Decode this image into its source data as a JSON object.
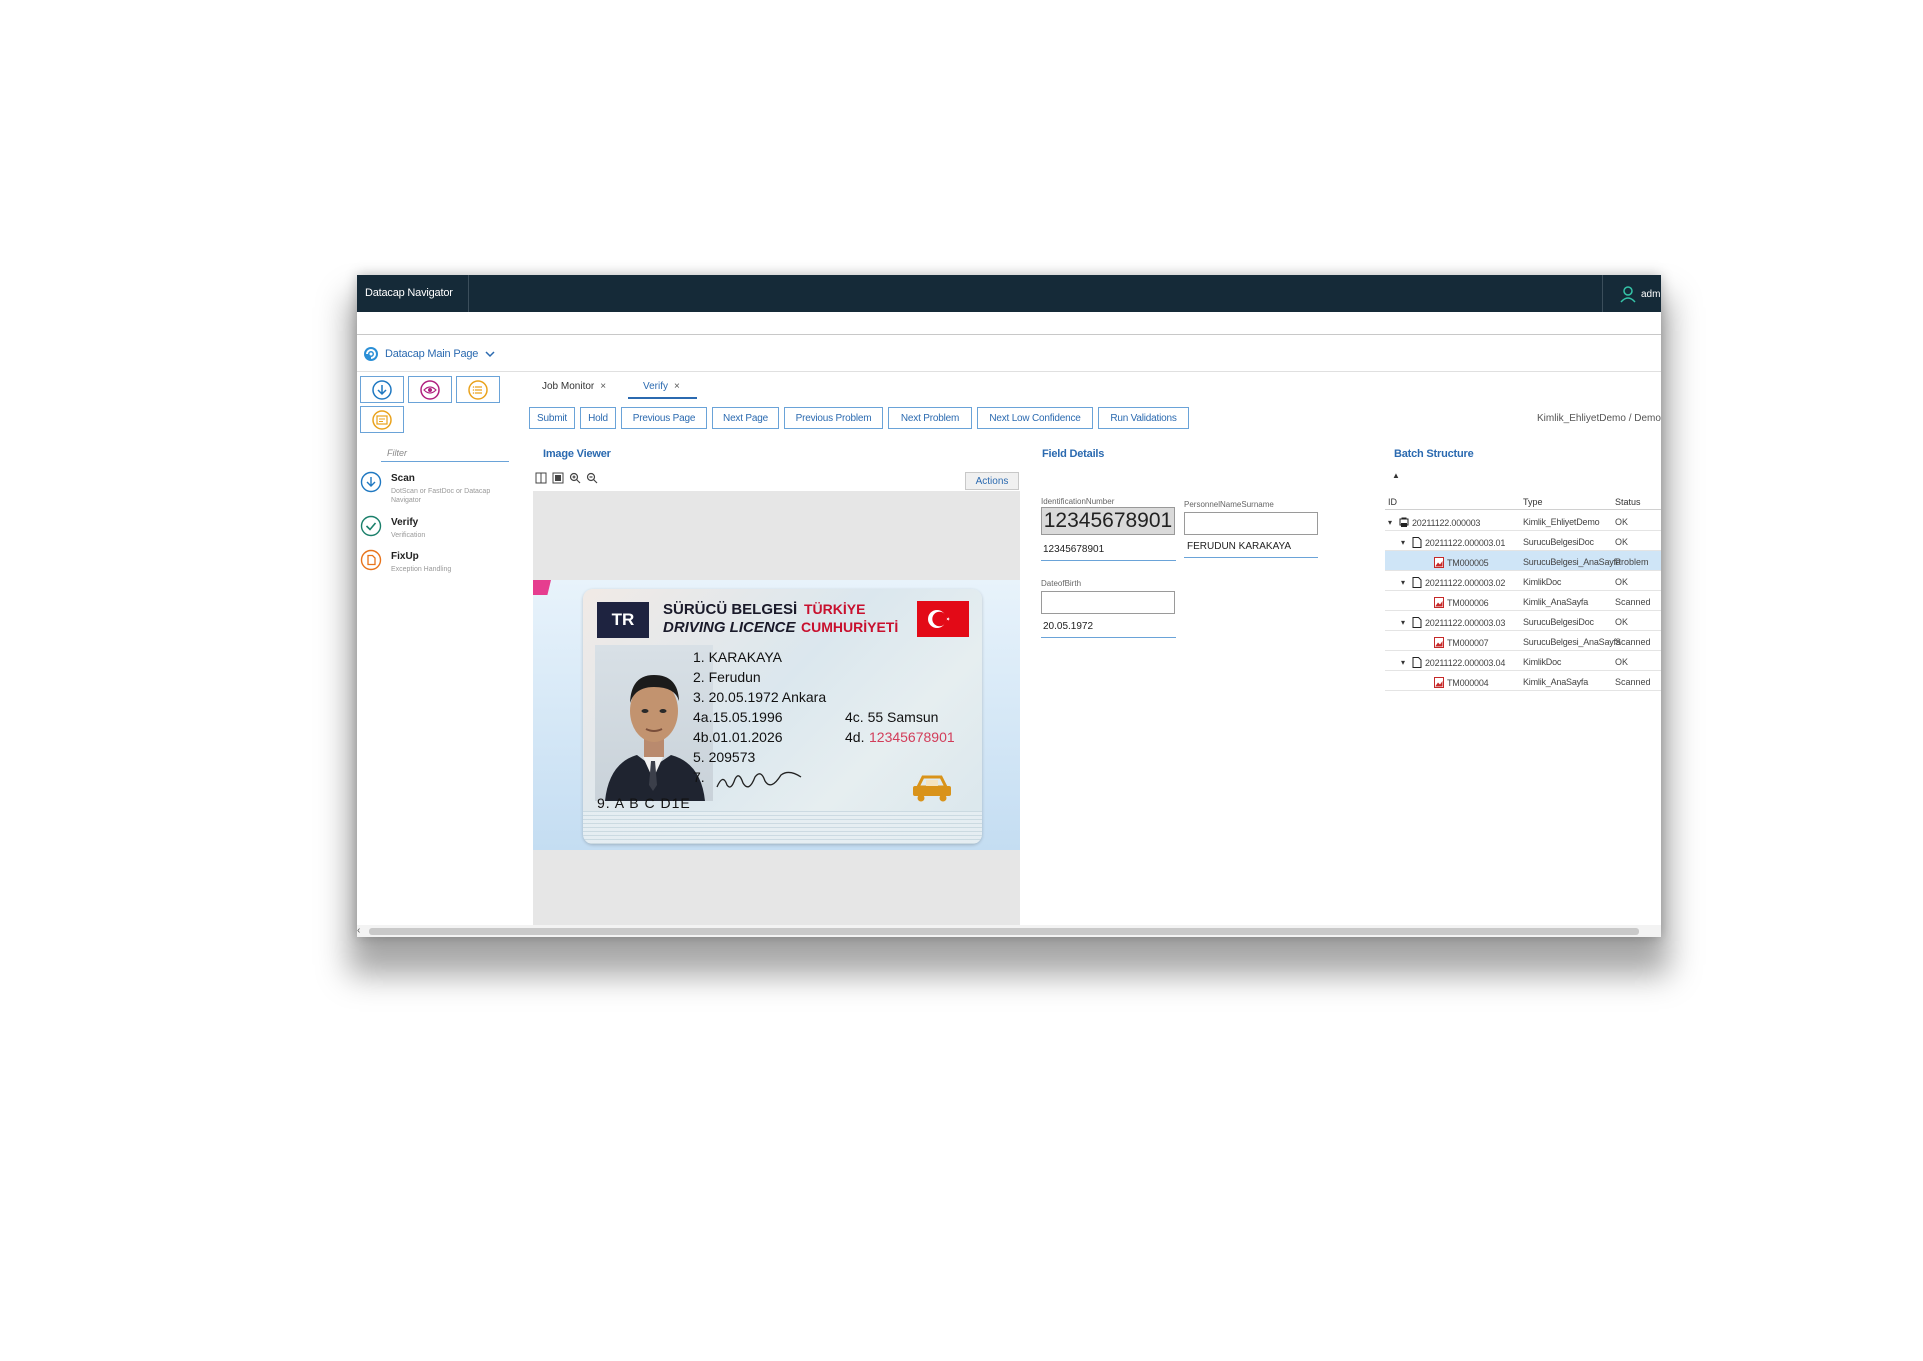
{
  "header": {
    "app_title": "Datacap Navigator",
    "user": "adm"
  },
  "main_page": {
    "label": "Datacap Main Page"
  },
  "sidebar": {
    "filter_placeholder": "Filter",
    "tasks": [
      {
        "title": "Scan",
        "subtitle": "DotScan or FastDoc or Datacap Navigator",
        "icon": "download-circle-icon",
        "color": "#1f78c1"
      },
      {
        "title": "Verify",
        "subtitle": "Verification",
        "icon": "check-circle-icon",
        "color": "#1a7f6a"
      },
      {
        "title": "FixUp",
        "subtitle": "Exception Handling",
        "icon": "document-circle-icon",
        "color": "#e8731a"
      }
    ]
  },
  "tabs": [
    {
      "label": "Job Monitor",
      "close": "×"
    },
    {
      "label": "Verify",
      "close": "×"
    }
  ],
  "toolbar": {
    "buttons": [
      "Submit",
      "Hold",
      "Previous Page",
      "Next Page",
      "Previous Problem",
      "Next Problem",
      "Next Low Confidence",
      "Run Validations"
    ],
    "breadcrumb": "Kimlik_EhliyetDemo / Demo"
  },
  "image_viewer": {
    "title": "Image Viewer",
    "actions_label": "Actions",
    "card": {
      "country_code": "TR",
      "title_tr": "SÜRÜCÜ BELGESİ",
      "title_en": "DRIVING LICENCE",
      "country_tr1": "TÜRKİYE",
      "country_tr2": "CUMHURİYETİ",
      "line1": "1.  KARAKAYA",
      "line2": "2.  Ferudun",
      "line3": "3.  20.05.1972 Ankara",
      "line4a": "4a.15.05.1996",
      "line4c": "4c. 55 Samsun",
      "line4b": "4b.01.01.2026",
      "line4d_label": "4d.",
      "line4d_value": "12345678901",
      "line5": "5.  209573",
      "line7": "7.",
      "categories": "9. A B C D1E"
    }
  },
  "field_details": {
    "title": "Field Details",
    "identification_label": "IdentificationNumber",
    "identification_snippet": "12345678901",
    "identification_value": "12345678901",
    "name_label": "PersonnelNameSurname",
    "name_value": "FERUDUN KARAKAYA",
    "dob_label": "DateofBirth",
    "dob_value": "20.05.1972"
  },
  "batch_structure": {
    "title": "Batch Structure",
    "sort_indicator": "▲",
    "columns": [
      "ID",
      "Type",
      "Status"
    ],
    "rows": [
      {
        "id": "20211122.000003",
        "type": "Kimlik_EhliyetDemo",
        "status": "OK",
        "level": 0,
        "kind": "batch",
        "caret": "▾"
      },
      {
        "id": "20211122.000003.01",
        "type": "SurucuBelgesiDoc",
        "status": "OK",
        "level": 1,
        "kind": "doc",
        "caret": "▾"
      },
      {
        "id": "TM000005",
        "type": "SurucuBelgesi_AnaSayfa",
        "status": "Problem",
        "level": 2,
        "kind": "page",
        "caret": "",
        "selected": true
      },
      {
        "id": "20211122.000003.02",
        "type": "KimlikDoc",
        "status": "OK",
        "level": 1,
        "kind": "doc",
        "caret": "▾"
      },
      {
        "id": "TM000006",
        "type": "Kimlik_AnaSayfa",
        "status": "Scanned",
        "level": 2,
        "kind": "page",
        "caret": ""
      },
      {
        "id": "20211122.000003.03",
        "type": "SurucuBelgesiDoc",
        "status": "OK",
        "level": 1,
        "kind": "doc",
        "caret": "▾"
      },
      {
        "id": "TM000007",
        "type": "SurucuBelgesi_AnaSayfa",
        "status": "Scanned",
        "level": 2,
        "kind": "page",
        "caret": ""
      },
      {
        "id": "20211122.000003.04",
        "type": "KimlikDoc",
        "status": "OK",
        "level": 1,
        "kind": "doc",
        "caret": "▾"
      },
      {
        "id": "TM000004",
        "type": "Kimlik_AnaSayfa",
        "status": "Scanned",
        "level": 2,
        "kind": "page",
        "caret": ""
      }
    ]
  },
  "scrollbar": {
    "left_arrow": "‹"
  }
}
